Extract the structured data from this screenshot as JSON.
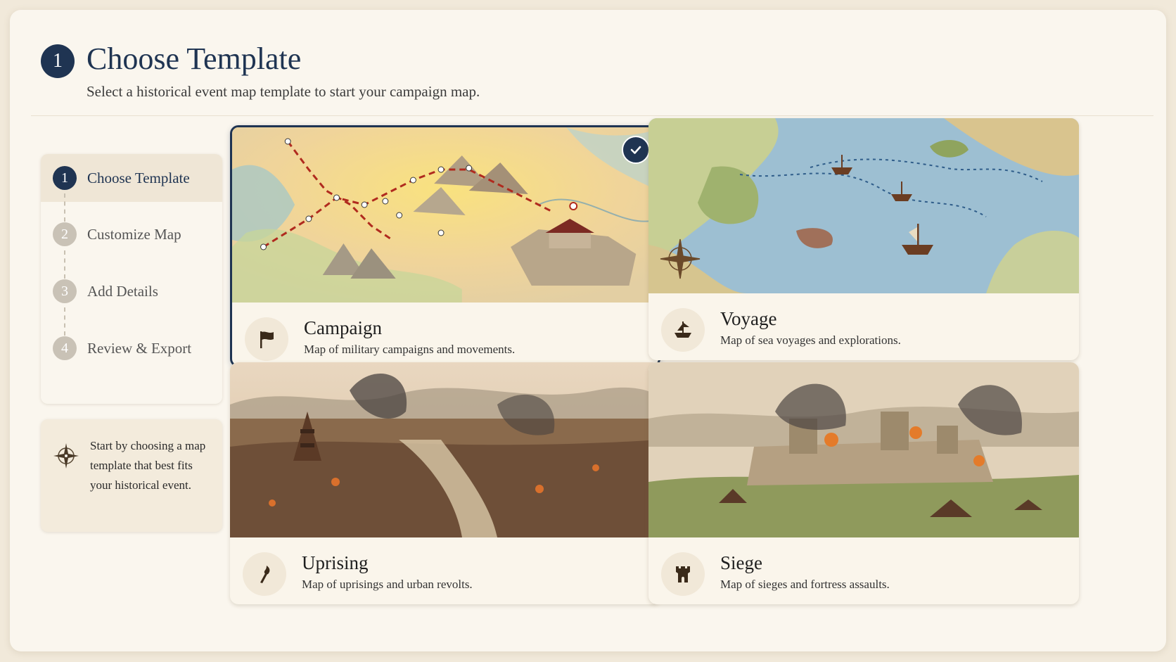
{
  "header": {
    "step_number": "1",
    "title": "Choose Template",
    "subtitle": "Select a historical event map template to start your campaign map."
  },
  "stepper": {
    "steps": [
      {
        "number": "1",
        "label": "Choose Template",
        "active": true
      },
      {
        "number": "2",
        "label": "Customize Map",
        "active": false
      },
      {
        "number": "3",
        "label": "Add Details",
        "active": false
      },
      {
        "number": "4",
        "label": "Review & Export",
        "active": false
      }
    ]
  },
  "tip": {
    "icon": "compass-rose-icon",
    "text": "Start by choosing a map template that best fits your historical event."
  },
  "templates": [
    {
      "title": "Campaign",
      "description": "Map of military campaigns and movements.",
      "icon": "flag-icon",
      "selected": true
    },
    {
      "title": "Voyage",
      "description": "Map of sea voyages and explorations.",
      "icon": "ship-icon",
      "selected": false
    },
    {
      "title": "Uprising",
      "description": "Map of uprisings and urban revolts.",
      "icon": "torch-icon",
      "selected": false
    },
    {
      "title": "Siege",
      "description": "Map of sieges and fortress assaults.",
      "icon": "tower-icon",
      "selected": false
    }
  ],
  "colors": {
    "accent": "#1f3452",
    "panel": "#faf6ee",
    "background": "#f1e9da"
  }
}
